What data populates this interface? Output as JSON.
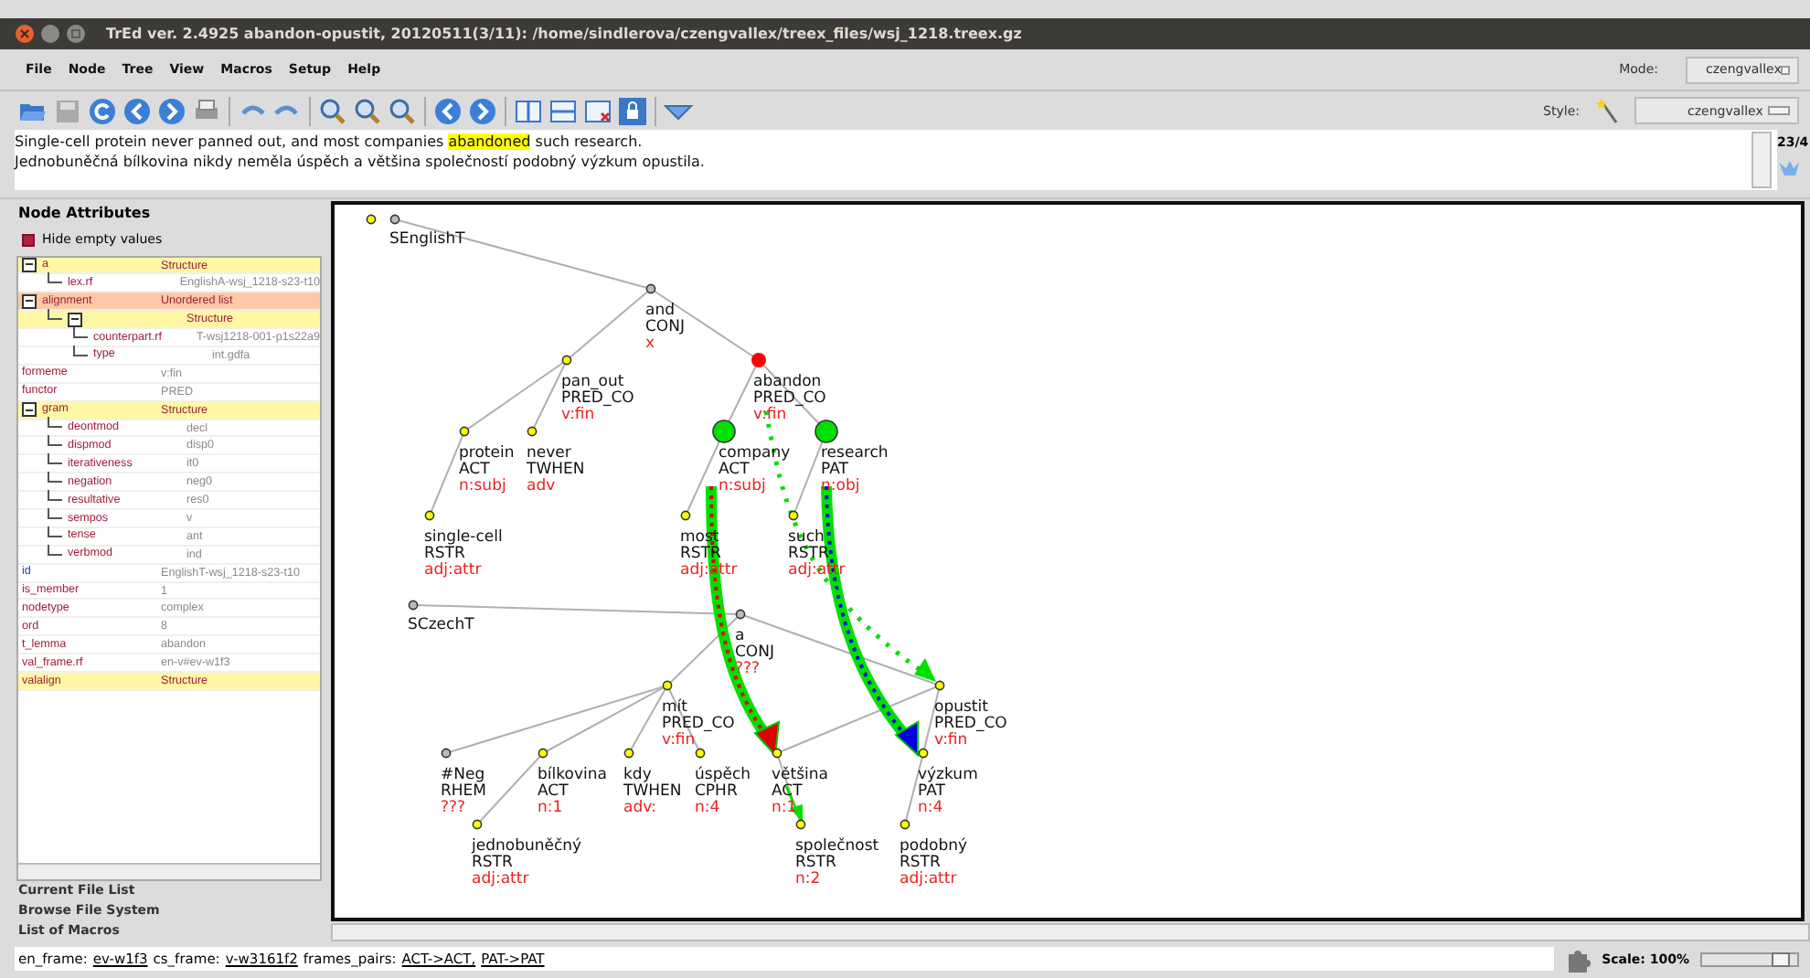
{
  "window": {
    "title": "TrEd ver. 2.4925    abandon-opustit, 20120511(3/11): /home/sindlerova/czengvallex/treex_files/wsj_1218.treex.gz"
  },
  "menu": [
    "File",
    "Node",
    "Tree",
    "View",
    "Macros",
    "Setup",
    "Help"
  ],
  "mode": {
    "label": "Mode:",
    "value": "czengvallex"
  },
  "style": {
    "label": "Style:",
    "value": "czengvallex"
  },
  "sentences": [
    {
      "before": "Single-cell protein never panned out, and most companies ",
      "highlighted": "abandoned",
      "after": " such research."
    },
    {
      "before": "Jednobuněčná bílkovina nikdy neměla úspěch a většina společností podobný výzkum opustila."
    }
  ],
  "tree_counter": "23/4",
  "attributes_panel": {
    "title": "Node Attributes",
    "hide_empty": {
      "label": "Hide empty values",
      "checked": true
    },
    "rows": [
      {
        "name": "a",
        "value": "Structure",
        "kind": "structure",
        "expanded": true,
        "children": [
          {
            "name": "lex.rf",
            "value": "EnglishA-wsj_1218-s23-t10",
            "kind": "value"
          }
        ]
      },
      {
        "name": "alignment",
        "value": "Unordered list",
        "kind": "list",
        "expanded": true,
        "children": [
          {
            "value": "Structure",
            "kind": "structure",
            "expanded": true,
            "children": [
              {
                "name": "counterpart.rf",
                "value": "T-wsj1218-001-p1s22a9",
                "kind": "value"
              },
              {
                "name": "type",
                "value": "int.gdfa",
                "kind": "value"
              }
            ]
          }
        ]
      },
      {
        "name": "formeme",
        "value": "v:fin",
        "kind": "value"
      },
      {
        "name": "functor",
        "value": "PRED",
        "kind": "value"
      },
      {
        "name": "gram",
        "value": "Structure",
        "kind": "structure",
        "expanded": true,
        "children": [
          {
            "name": "deontmod",
            "value": "decl",
            "kind": "value"
          },
          {
            "name": "dispmod",
            "value": "disp0",
            "kind": "value"
          },
          {
            "name": "iterativeness",
            "value": "it0",
            "kind": "value"
          },
          {
            "name": "negation",
            "value": "neg0",
            "kind": "value"
          },
          {
            "name": "resultative",
            "value": "res0",
            "kind": "value"
          },
          {
            "name": "sempos",
            "value": "v",
            "kind": "value"
          },
          {
            "name": "tense",
            "value": "ant",
            "kind": "value"
          },
          {
            "name": "verbmod",
            "value": "ind",
            "kind": "value"
          }
        ]
      },
      {
        "name": "id",
        "value": "EnglishT-wsj_1218-s23-t10",
        "kind": "key"
      },
      {
        "name": "is_member",
        "value": "1",
        "kind": "value"
      },
      {
        "name": "nodetype",
        "value": "complex",
        "kind": "value"
      },
      {
        "name": "ord",
        "value": "8",
        "kind": "value"
      },
      {
        "name": "t_lemma",
        "value": "abandon",
        "kind": "value"
      },
      {
        "name": "val_frame.rf",
        "value": "en-v#ev-w1f3",
        "kind": "value"
      },
      {
        "name": "valalign",
        "value": "Structure",
        "kind": "structure"
      }
    ]
  },
  "side_links": [
    "Current File List",
    "Browse File System",
    "List of Macros"
  ],
  "trees": [
    {
      "lemma": "SEnglishT",
      "kind": "root",
      "children": [
        {
          "lemma": "and",
          "functor": "CONJ",
          "formeme": "x",
          "kind": "grey",
          "children": [
            {
              "lemma": "pan_out",
              "functor": "PRED_CO",
              "formeme": "v:fin",
              "kind": "node",
              "children": [
                {
                  "lemma": "protein",
                  "functor": "ACT",
                  "formeme": "n:subj",
                  "kind": "node",
                  "children": [
                    {
                      "lemma": "single-cell",
                      "functor": "RSTR",
                      "formeme": "adj:attr",
                      "kind": "node"
                    }
                  ]
                },
                {
                  "lemma": "never",
                  "functor": "TWHEN",
                  "formeme": "adv",
                  "kind": "node"
                }
              ]
            },
            {
              "lemma": "abandon",
              "functor": "PRED_CO",
              "formeme": "v:fin",
              "kind": "current",
              "children": [
                {
                  "lemma": "company",
                  "functor": "ACT",
                  "formeme": "n:subj",
                  "kind": "aligned",
                  "children": [
                    {
                      "lemma": "most",
                      "functor": "RSTR",
                      "formeme": "adj:attr",
                      "kind": "node"
                    }
                  ]
                },
                {
                  "lemma": "research",
                  "functor": "PAT",
                  "formeme": "n:obj",
                  "kind": "aligned",
                  "children": [
                    {
                      "lemma": "such",
                      "functor": "RSTR",
                      "formeme": "adj:attr",
                      "kind": "node"
                    }
                  ]
                }
              ]
            }
          ]
        }
      ]
    },
    {
      "lemma": "SCzechT",
      "kind": "root",
      "children": [
        {
          "lemma": "a",
          "functor": "CONJ",
          "formeme": "???",
          "kind": "grey",
          "children": [
            {
              "lemma": "mít",
              "functor": "PRED_CO",
              "formeme": "v:fin",
              "kind": "node",
              "children": [
                {
                  "lemma": "#Neg",
                  "functor": "RHEM",
                  "formeme": "???",
                  "kind": "grey"
                },
                {
                  "lemma": "bílkovina",
                  "functor": "ACT",
                  "formeme": "n:1",
                  "kind": "node",
                  "children": [
                    {
                      "lemma": "jednobuněčný",
                      "functor": "RSTR",
                      "formeme": "adj:attr",
                      "kind": "node"
                    }
                  ]
                },
                {
                  "lemma": "kdy",
                  "functor": "TWHEN",
                  "formeme": "adv:",
                  "kind": "node"
                },
                {
                  "lemma": "úspěch",
                  "functor": "CPHR",
                  "formeme": "n:4",
                  "kind": "node"
                }
              ]
            },
            {
              "lemma": "opustit",
              "functor": "PRED_CO",
              "formeme": "v:fin",
              "kind": "node",
              "children": [
                {
                  "lemma": "většina",
                  "functor": "ACT",
                  "formeme": "n:1",
                  "kind": "node",
                  "children": [
                    {
                      "lemma": "společnost",
                      "functor": "RSTR",
                      "formeme": "n:2",
                      "kind": "node"
                    }
                  ]
                },
                {
                  "lemma": "výzkum",
                  "functor": "PAT",
                  "formeme": "n:4",
                  "kind": "node",
                  "children": [
                    {
                      "lemma": "podobný",
                      "functor": "RSTR",
                      "formeme": "adj:attr",
                      "kind": "node"
                    }
                  ]
                }
              ]
            }
          ]
        }
      ]
    }
  ],
  "status": {
    "parts": [
      {
        "text": "en_frame:",
        "link": false
      },
      {
        "text": "ev-w1f3",
        "link": true
      },
      {
        "text": "cs_frame:",
        "link": false
      },
      {
        "text": "v-w3161f2",
        "link": true
      },
      {
        "text": "frames_pairs:",
        "link": false
      },
      {
        "text": "ACT->ACT,",
        "link": true
      },
      {
        "text": "PAT->PAT",
        "link": true
      }
    ],
    "scale": {
      "label": "Scale: 100%",
      "level": 0.8
    }
  }
}
